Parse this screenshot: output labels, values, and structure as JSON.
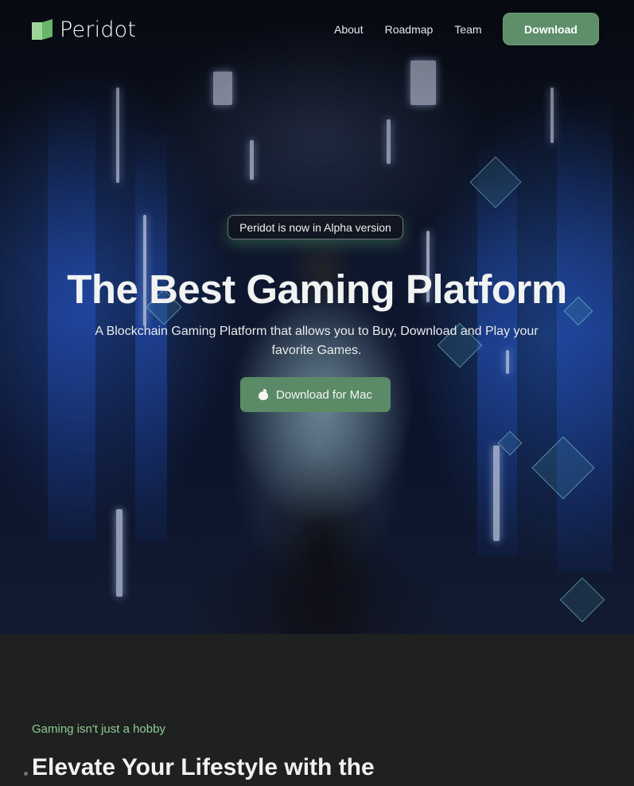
{
  "brand": {
    "name": "Peridot"
  },
  "nav": {
    "links": [
      "About",
      "Roadmap",
      "Team"
    ],
    "download_label": "Download"
  },
  "hero": {
    "badge": "Peridot is now in Alpha version",
    "title": "The Best Gaming Platform",
    "subtitle": "A Blockchain Gaming Platform that allows you to Buy, Download and Play your favorite Games.",
    "cta_label": "Download for Mac",
    "cta_icon": "apple-icon"
  },
  "section2": {
    "eyebrow": "Gaming isn't just a hobby",
    "title": "Elevate Your Lifestyle with the"
  },
  "colors": {
    "accent": "#5e8f6a",
    "eyebrow": "#8fcb93",
    "page_bg": "#1f2020"
  }
}
